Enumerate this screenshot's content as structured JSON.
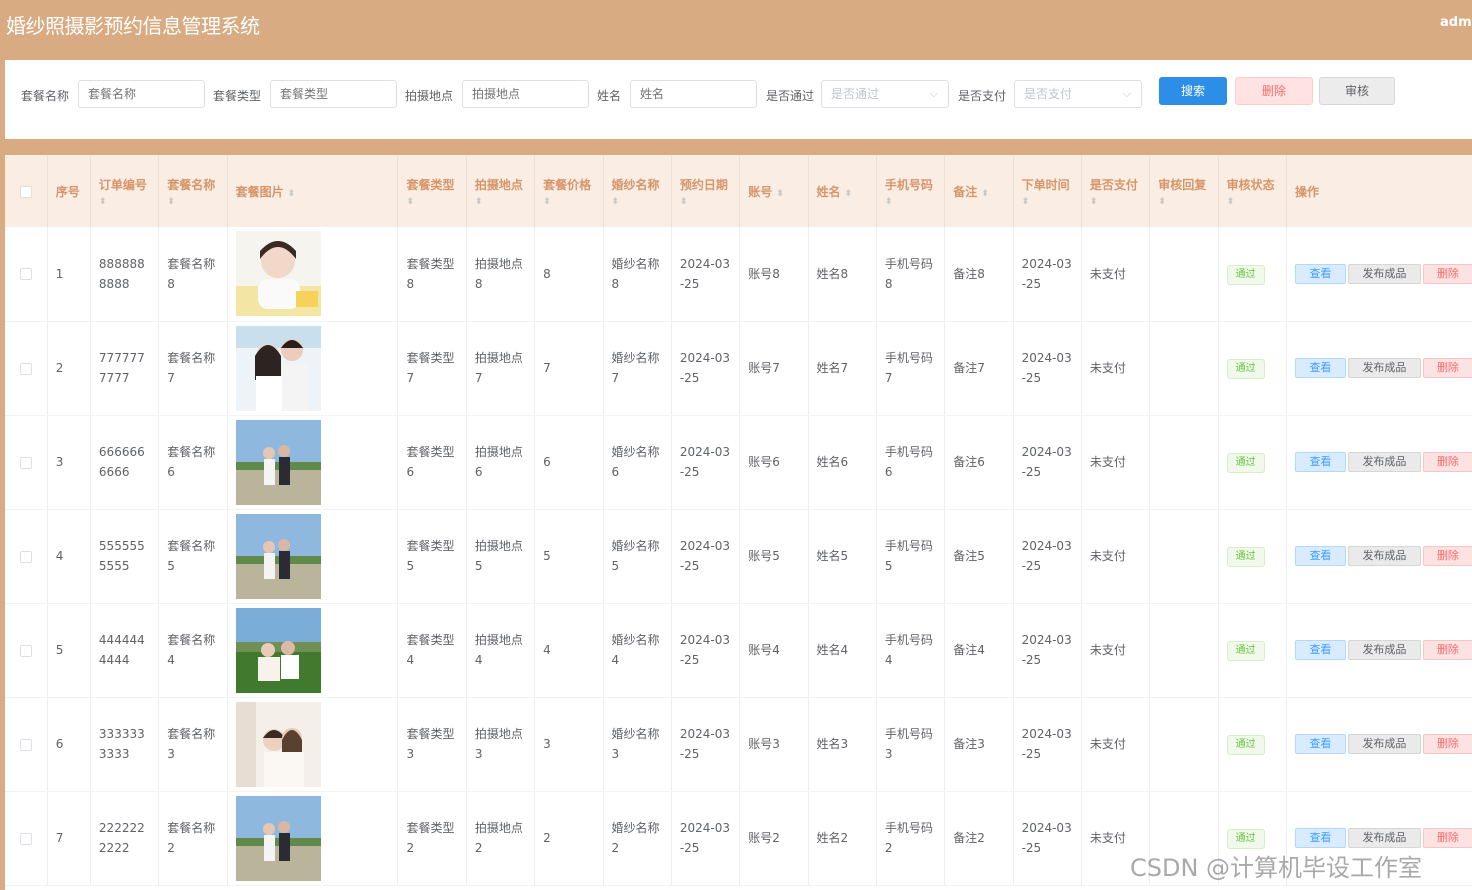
{
  "app": {
    "title": "婚纱照摄影预约信息管理系统",
    "user": "admin"
  },
  "search": {
    "package_name": {
      "label": "套餐名称",
      "placeholder": "套餐名称"
    },
    "package_type": {
      "label": "套餐类型",
      "placeholder": "套餐类型"
    },
    "location": {
      "label": "拍摄地点",
      "placeholder": "拍摄地点"
    },
    "name": {
      "label": "姓名",
      "placeholder": "姓名"
    },
    "approved": {
      "label": "是否通过",
      "placeholder": "是否通过"
    },
    "paid": {
      "label": "是否支付",
      "placeholder": "是否支付"
    },
    "buttons": {
      "search": "搜索",
      "delete": "删除",
      "audit": "审核"
    }
  },
  "table": {
    "headers": {
      "index": "序号",
      "order_no": "订单编号",
      "package_name": "套餐名称",
      "package_image": "套餐图片",
      "package_type": "套餐类型",
      "location": "拍摄地点",
      "price": "套餐价格",
      "dress_name": "婚纱名称",
      "booking_date": "预约日期",
      "account": "账号",
      "name": "姓名",
      "phone": "手机号码",
      "remark": "备注",
      "order_time": "下单时间",
      "paid": "是否支付",
      "audit_reply": "审核回复",
      "audit_status": "审核状态",
      "actions": "操作"
    },
    "action_labels": {
      "view": "查看",
      "publish": "发布成品",
      "delete": "删除"
    },
    "rows": [
      {
        "index": "1",
        "order_no": "8888888888",
        "package_name": "套餐名称8",
        "package_type": "套餐类型8",
        "location": "拍摄地点8",
        "price": "8",
        "dress_name": "婚纱名称8",
        "booking_date": "2024-03-25",
        "account": "账号8",
        "name": "姓名8",
        "phone": "手机号码8",
        "remark": "备注8",
        "order_time": "2024-03-25",
        "paid": "未支付",
        "audit_reply": "",
        "audit_status": "通过",
        "image": "photo-girl-portrait"
      },
      {
        "index": "2",
        "order_no": "7777777777",
        "package_name": "套餐名称7",
        "package_type": "套餐类型7",
        "location": "拍摄地点7",
        "price": "7",
        "dress_name": "婚纱名称7",
        "booking_date": "2024-03-25",
        "account": "账号7",
        "name": "姓名7",
        "phone": "手机号码7",
        "remark": "备注7",
        "order_time": "2024-03-25",
        "paid": "未支付",
        "audit_reply": "",
        "audit_status": "通过",
        "image": "photo-couple-indoor"
      },
      {
        "index": "3",
        "order_no": "6666666666",
        "package_name": "套餐名称6",
        "package_type": "套餐类型6",
        "location": "拍摄地点6",
        "price": "6",
        "dress_name": "婚纱名称6",
        "booking_date": "2024-03-25",
        "account": "账号6",
        "name": "姓名6",
        "phone": "手机号码6",
        "remark": "备注6",
        "order_time": "2024-03-25",
        "paid": "未支付",
        "audit_reply": "",
        "audit_status": "通过",
        "image": "photo-couple-outdoor"
      },
      {
        "index": "4",
        "order_no": "5555555555",
        "package_name": "套餐名称5",
        "package_type": "套餐类型5",
        "location": "拍摄地点5",
        "price": "5",
        "dress_name": "婚纱名称5",
        "booking_date": "2024-03-25",
        "account": "账号5",
        "name": "姓名5",
        "phone": "手机号码5",
        "remark": "备注5",
        "order_time": "2024-03-25",
        "paid": "未支付",
        "audit_reply": "",
        "audit_status": "通过",
        "image": "photo-couple-outdoor"
      },
      {
        "index": "5",
        "order_no": "4444444444",
        "package_name": "套餐名称4",
        "package_type": "套餐类型4",
        "location": "拍摄地点4",
        "price": "4",
        "dress_name": "婚纱名称4",
        "booking_date": "2024-03-25",
        "account": "账号4",
        "name": "姓名4",
        "phone": "手机号码4",
        "remark": "备注4",
        "order_time": "2024-03-25",
        "paid": "未支付",
        "audit_reply": "",
        "audit_status": "通过",
        "image": "photo-couple-grass"
      },
      {
        "index": "6",
        "order_no": "3333333333",
        "package_name": "套餐名称3",
        "package_type": "套餐类型3",
        "location": "拍摄地点3",
        "price": "3",
        "dress_name": "婚纱名称3",
        "booking_date": "2024-03-25",
        "account": "账号3",
        "name": "姓名3",
        "phone": "手机号码3",
        "remark": "备注3",
        "order_time": "2024-03-25",
        "paid": "未支付",
        "audit_reply": "",
        "audit_status": "通过",
        "image": "photo-couple-bright"
      },
      {
        "index": "7",
        "order_no": "2222222222",
        "package_name": "套餐名称2",
        "package_type": "套餐类型2",
        "location": "拍摄地点2",
        "price": "2",
        "dress_name": "婚纱名称2",
        "booking_date": "2024-03-25",
        "account": "账号2",
        "name": "姓名2",
        "phone": "手机号码2",
        "remark": "备注2",
        "order_time": "2024-03-25",
        "paid": "未支付",
        "audit_reply": "",
        "audit_status": "通过",
        "image": "photo-couple-outdoor"
      }
    ]
  },
  "watermark": "CSDN @计算机毕设工作室"
}
